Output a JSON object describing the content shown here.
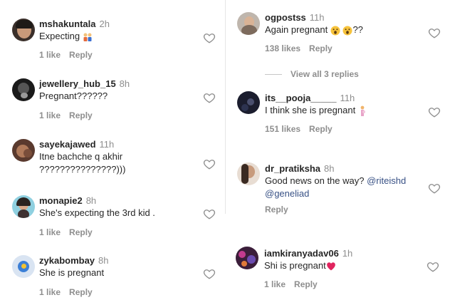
{
  "comments_left": [
    {
      "username": "mshakuntala",
      "time": "2h",
      "text": "Expecting",
      "likes": "1 like",
      "reply": "Reply"
    },
    {
      "username": "jewellery_hub_15",
      "time": "8h",
      "text": "Pregnant??????",
      "likes": "1 like",
      "reply": "Reply"
    },
    {
      "username": "sayekajawed",
      "time": "11h",
      "text": "Itne bachche q akhir",
      "text2": "???????????????)))",
      "likes": "1 like",
      "reply": "Reply"
    },
    {
      "username": "monapie2",
      "time": "8h",
      "text": "She's expecting the 3rd kid .",
      "likes": "1 like",
      "reply": "Reply"
    },
    {
      "username": "zykabombay",
      "time": "8h",
      "text": "She is pregnant",
      "likes": "1 like",
      "reply": "Reply"
    }
  ],
  "comments_right": [
    {
      "username": "ogpostss",
      "time": "11h",
      "text": "Again pregnant",
      "text_suffix": "??",
      "likes": "138 likes",
      "reply": "Reply"
    },
    {
      "username": "its__pooja_____",
      "time": "11h",
      "text": "I think she is pregnant",
      "likes": "151 likes",
      "reply": "Reply"
    },
    {
      "username": "dr_pratiksha",
      "time": "8h",
      "text": "Good news on the way?",
      "mention1": "@riteishd",
      "mention2": "@geneliad",
      "reply": "Reply"
    },
    {
      "username": "iamkiranyadav06",
      "time": "1h",
      "text": "Shi is pregnant",
      "likes": "1 like",
      "reply": "Reply"
    }
  ],
  "view_replies": "View all 3 replies",
  "icons": {
    "like": "heart-outline-icon"
  },
  "colors": {
    "mention": "#385185",
    "muted": "#8e8e8e",
    "heart_red": "#e0245e"
  }
}
